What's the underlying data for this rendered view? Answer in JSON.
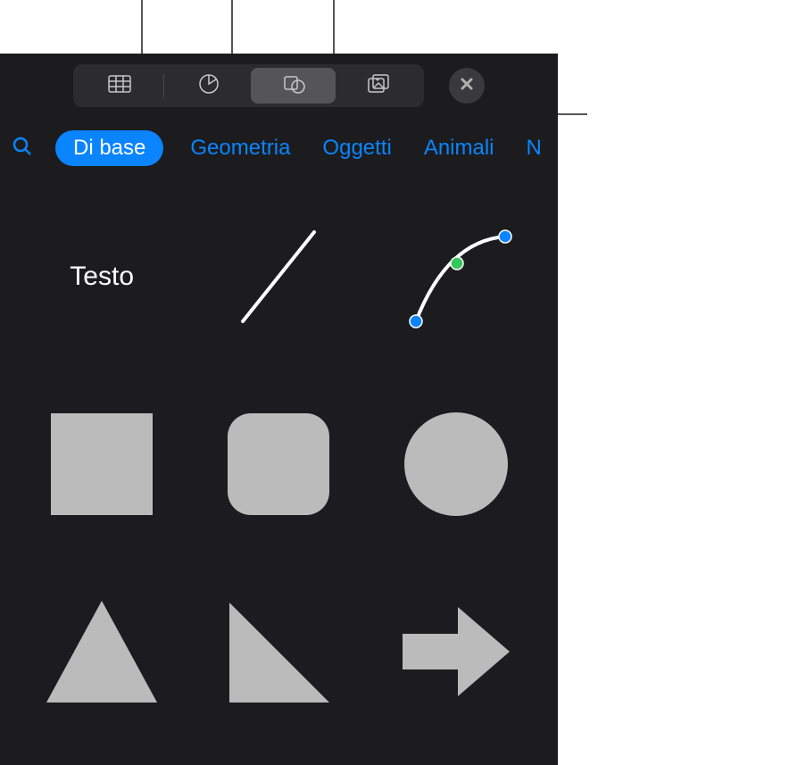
{
  "toolbar": {
    "items": [
      {
        "name": "table-icon"
      },
      {
        "name": "chart-icon"
      },
      {
        "name": "shapes-icon"
      },
      {
        "name": "media-icon"
      }
    ],
    "selected_index": 2
  },
  "categories": {
    "selected_index": 0,
    "items": [
      "Di base",
      "Geometria",
      "Oggetti",
      "Animali",
      "N"
    ]
  },
  "shapes": {
    "text_tool_label": "Testo",
    "colors": {
      "shape_fill": "#bbbbbb",
      "line_stroke": "#ffffff",
      "node_blue": "#0a84ff",
      "node_green": "#34c759"
    }
  }
}
